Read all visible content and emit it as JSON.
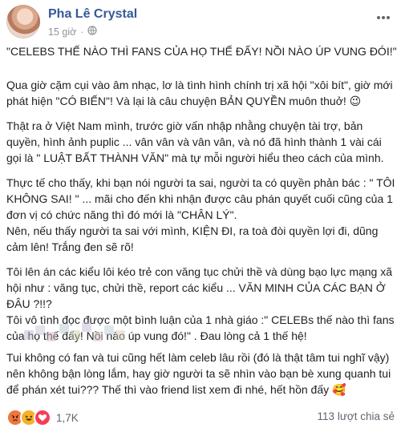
{
  "post": {
    "author": "Pha Lê Crystal",
    "time": "15 giờ",
    "separator": "·",
    "quote": "\"CELEBS THẾ NÀO THÌ FANS CỦA HỌ THẾ ĐẤY! NỒI NÀO ÚP VUNG ĐÓI!\"",
    "lines": [
      "Qua giờ cặm cụi vào âm nhạc, lơ là tình hình chính trị xã hội \"xôi bít\", giờ mới",
      "phát hiện \"CÓ BIẾN\"! Và lại là câu chuyện BẢN QUYỀN muôn thuở! 😉",
      "Thật ra ở Việt Nam mình, trước giờ vấn nhập nhằng chuyện tài trợ, bản",
      "quyền, hình ảnh puplic ... vân vân và vân vân, và nó đã hình thành 1 vài cái",
      "gọi là \" LUẬT BẤT THÀNH VĂN\" mà tự mỗi người hiểu theo cách của mình.",
      "Thực tế cho thấy, khi bạn nói người ta sai, người ta có quyền phản bác : \" TÔI",
      "KHÔNG SAI! \" ... mãi cho đến khi nhận được câu phán quyết cuối cũng của 1",
      "đơn vị có chức năng thì đó mới là \"CHÂN LÝ\".",
      "Nên, nếu thấy người ta sai với mình, KIỆN ĐI, ra toà đòi quyền lợi đi, dũng",
      "cảm lên! Trắng đen sẽ rõ!",
      "Tôi lên án các kiểu lôi kéo trẻ con văng tục chửi thề và dùng bạo lực mạng xã",
      "hội như : văng tục, chửi thề, report các kiểu ... VĂN MINH CỦA CÁC BẠN Ở",
      "ĐÂU ?!!?",
      "Tôi vô tình đọc được một bình luận của 1 nhà giáo :\" CELEBs thế nào thì fans",
      "của họ thế đấy! Nồi nào úp vung đó!\" . Đau lòng cả 1 thế hệ!",
      "Tui không có fan và tui cũng hết làm celeb lâu rồi (đó là thật tâm tui nghĩ vậy)",
      "nên không bận lòng lắm, hay giờ người ta sẽ nhìn vào bạn bè xung quanh tui",
      "để phán xét tui??? Thế thì vào friend list xem đi nhé, hết hồn đấy 🥰"
    ]
  },
  "footer": {
    "reactions": [
      "angry",
      "haha",
      "love"
    ],
    "reaction_count": "1,7K",
    "shares": "113 lượt chia sẻ"
  },
  "colors": {
    "link": "#365899",
    "muted": "#90949c",
    "angry": "#f0763b",
    "haha": "#f7b125",
    "love": "#f33e58"
  },
  "icons": [
    "globe-icon",
    "more-options-icon",
    "angry-reaction-icon",
    "haha-reaction-icon",
    "love-reaction-icon"
  ]
}
